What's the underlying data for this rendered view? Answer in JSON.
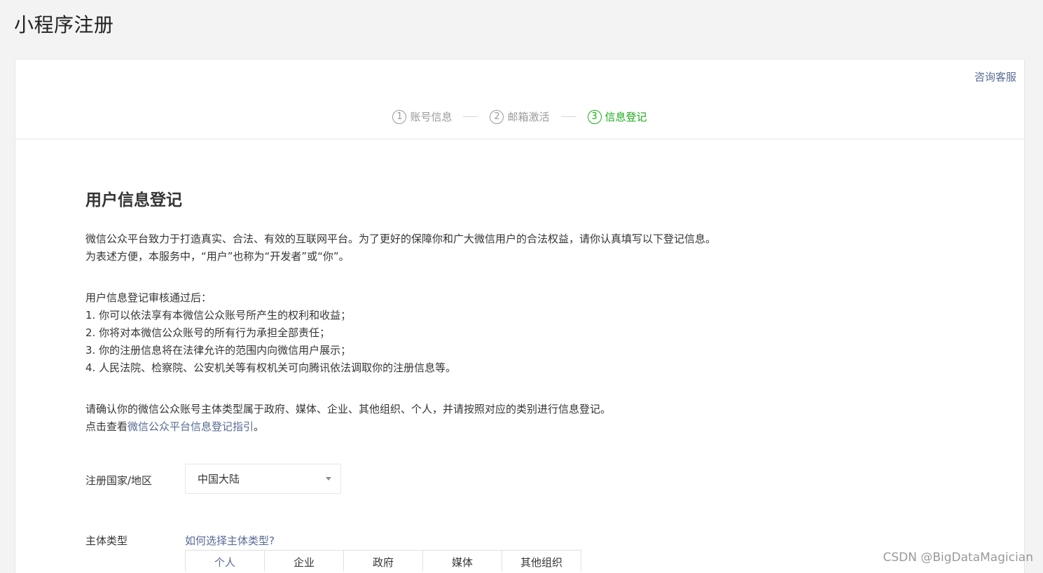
{
  "page": {
    "title": "小程序注册"
  },
  "header": {
    "consult_label": "咨询客服"
  },
  "steps": [
    {
      "num": "1",
      "label": "账号信息"
    },
    {
      "num": "2",
      "label": "邮箱激活"
    },
    {
      "num": "3",
      "label": "信息登记"
    }
  ],
  "content": {
    "section_title": "用户信息登记",
    "intro": [
      "微信公众平台致力于打造真实、合法、有效的互联网平台。为了更好的保障你和广大微信用户的合法权益，请你认真填写以下登记信息。",
      "为表述方便，本服务中，“用户”也称为“开发者”或“你”。"
    ],
    "after_title": "用户信息登记审核通过后：",
    "after_items": [
      "1. 你可以依法享有本微信公众账号所产生的权利和收益；",
      "2. 你将对本微信公众账号的所有行为承担全部责任；",
      "3. 你的注册信息将在法律允许的范围内向微信用户展示；",
      "4. 人民法院、检察院、公安机关等有权机关可向腾讯依法调取你的注册信息等。"
    ],
    "confirm_text": "请确认你的微信公众账号主体类型属于政府、媒体、企业、其他组织、个人，并请按照对应的类别进行信息登记。",
    "guide_prefix": "点击查看",
    "guide_link": "微信公众平台信息登记指引",
    "guide_suffix": "。"
  },
  "form": {
    "country_label": "注册国家/地区",
    "country_value": "中国大陆",
    "subject_label": "主体类型",
    "subject_help": "如何选择主体类型?",
    "subject_types": [
      "个人",
      "企业",
      "政府",
      "媒体",
      "其他组织"
    ]
  },
  "watermark": "CSDN @BigDataMagician",
  "colors": {
    "link": "#576b95",
    "active_step": "#1aad19",
    "inactive_step": "#9a9a9a",
    "background": "#f3f3f4"
  }
}
